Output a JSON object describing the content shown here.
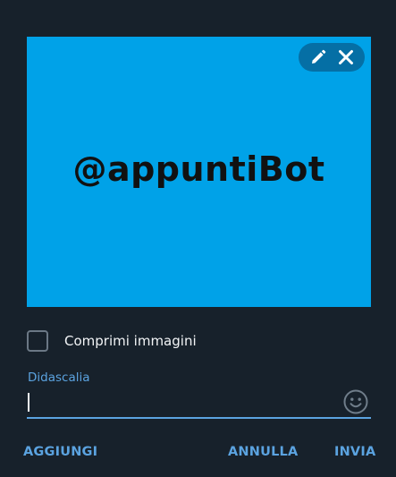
{
  "preview": {
    "text": "@appuntiBot",
    "background": "#00a2e8"
  },
  "tools": {
    "edit_icon": "pencil-icon",
    "close_icon": "close-icon"
  },
  "options": {
    "compress_label": "Comprimi immagini",
    "compress_checked": false
  },
  "caption": {
    "label": "Didascalia",
    "value": "",
    "emoji_icon": "smile-icon"
  },
  "footer": {
    "add_label": "AGGIUNGI",
    "cancel_label": "ANNULLA",
    "send_label": "INVIA"
  },
  "colors": {
    "background": "#17212b",
    "accent": "#5ba3e0",
    "text": "#f2f4f6"
  }
}
